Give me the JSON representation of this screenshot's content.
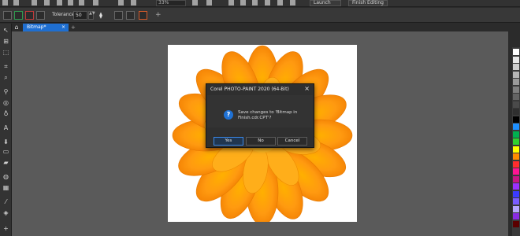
{
  "toolbar": {
    "zoom": "33%",
    "launch_label": "Launch",
    "finish_label": "Finish Editing"
  },
  "property_bar": {
    "tolerance_label": "Tolerance:",
    "tolerance_value": "50"
  },
  "tabs": {
    "home_icon": "home-icon",
    "document_tab": "Bitmap*",
    "close_glyph": "×",
    "new_tab_glyph": "+"
  },
  "dialog": {
    "title": "Corel PHOTO-PAINT 2020 (64-Bit)",
    "message": "Save changes to 'Bitmap in Finish.cdr.CPT'?",
    "question_glyph": "?",
    "close_glyph": "×",
    "yes_label": "Yes",
    "no_label": "No",
    "cancel_label": "Cancel"
  },
  "palette": {
    "colors": [
      "#ffffff",
      "#e8e8e8",
      "#cfcfcf",
      "#b5b5b5",
      "#9a9a9a",
      "#7f7f7f",
      "#646464",
      "#4a4a4a",
      "#2f2f2f",
      "#000000",
      "#1e90ff",
      "#00b050",
      "#2fd12f",
      "#ffff00",
      "#ff8c00",
      "#ff2d2d",
      "#ff1493",
      "#c71585",
      "#9b30ff",
      "#3b3bff",
      "#7a5cff",
      "#b7a6ff",
      "#8a2be2",
      "#5b0000"
    ]
  },
  "colors": {
    "accent": "#1f6fd1",
    "workspace": "#5a5a5a",
    "canvas": "#ffffff"
  }
}
